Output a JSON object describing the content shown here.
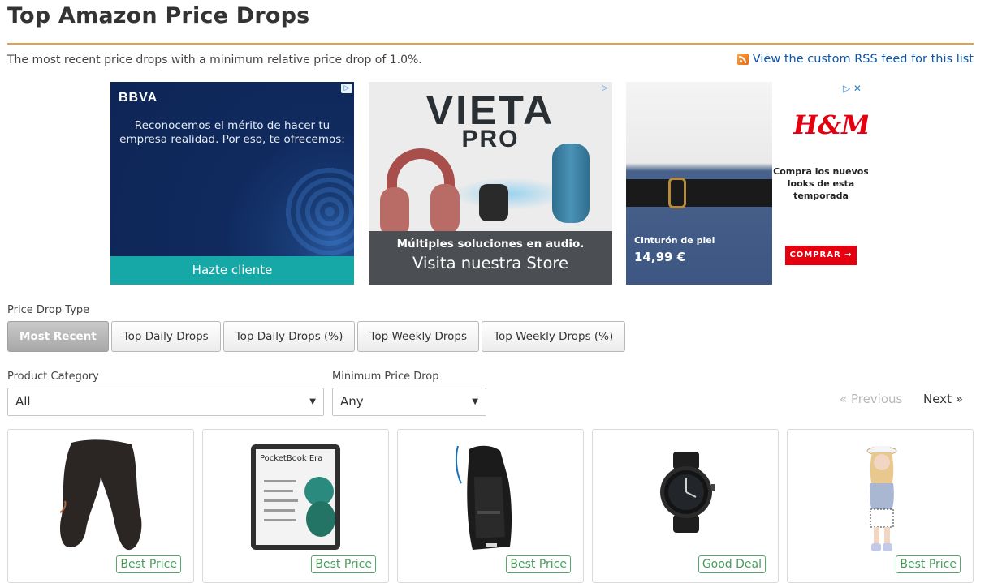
{
  "page": {
    "title": "Top Amazon Price Drops",
    "subtitle": "The most recent price drops with a minimum relative price drop of 1.0%.",
    "rss_link": "View the custom RSS feed for this list"
  },
  "ads": {
    "bbva": {
      "logo": "BBVA",
      "text_line1": "Reconocemos el mérito de hacer tu",
      "text_line2": "empresa realidad. Por eso, te ofrecemos:",
      "cta": "Hazte cliente"
    },
    "vieta": {
      "brand1": "VIETA",
      "brand2": "PRO",
      "line1": "Múltiples soluciones en audio.",
      "line2": "Visita nuestra Store"
    },
    "hm": {
      "logo": "H&M",
      "text_line1": "Compra los nuevos",
      "text_line2": "looks de esta",
      "text_line3": "temporada",
      "cta": "COMPRAR →",
      "photo_text1": "Cinturón de piel",
      "photo_text2": "14,99 €"
    }
  },
  "filters": {
    "price_drop_type_label": "Price Drop Type",
    "buttons": [
      "Most Recent",
      "Top Daily Drops",
      "Top Daily Drops (%)",
      "Top Weekly Drops",
      "Top Weekly Drops (%)"
    ],
    "active_button": "Most Recent",
    "category_label": "Product Category",
    "category_value": "All",
    "min_drop_label": "Minimum Price Drop",
    "min_drop_value": "Any"
  },
  "pagination": {
    "previous": "« Previous",
    "next": "Next »"
  },
  "products": [
    {
      "image": "football-pants",
      "badge": "Best Price"
    },
    {
      "image": "pocketbook-era-ereader",
      "badge": "Best Price",
      "image_text": "PocketBook Era"
    },
    {
      "image": "hydration-backpack",
      "badge": "Best Price"
    },
    {
      "image": "smartwatch",
      "badge": "Good Deal"
    },
    {
      "image": "doll",
      "badge": "Best Price"
    }
  ],
  "colors": {
    "rule": "#e2a04a",
    "link": "#0b55a8",
    "badge_green": "#4a9a5c"
  }
}
